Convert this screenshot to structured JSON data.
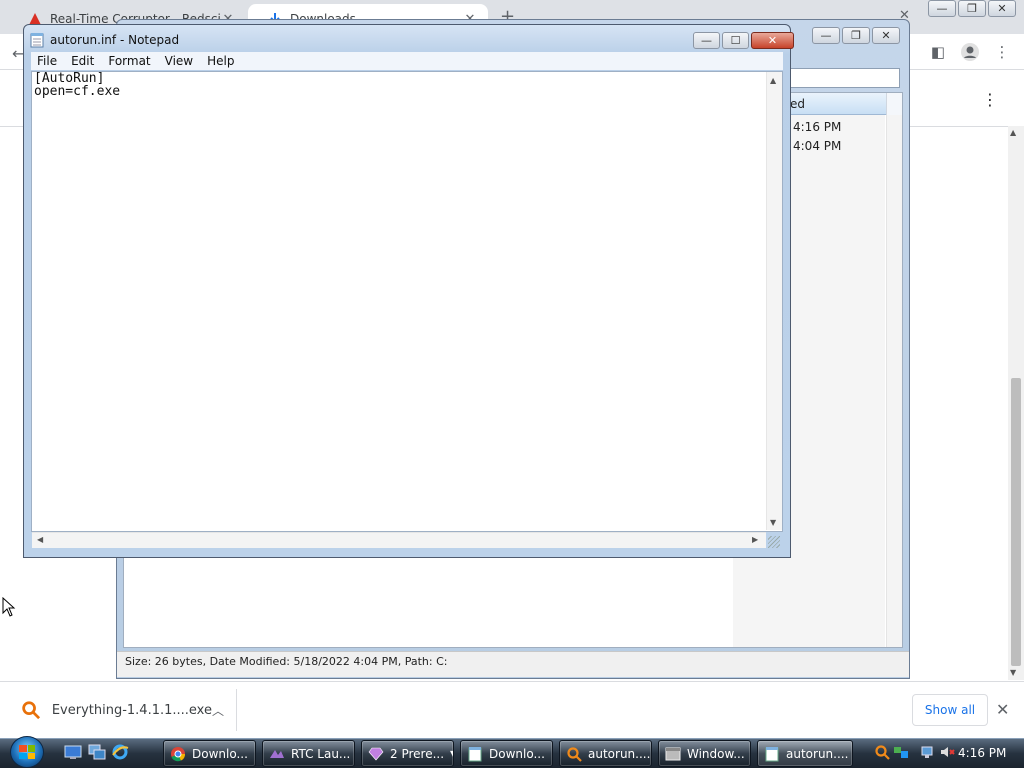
{
  "chrome": {
    "tabs": [
      {
        "title": "Real-Time Corruptor - Redscienti"
      },
      {
        "title": "Downloads"
      }
    ],
    "page_menu_icon": "more-vert-icon",
    "download_shelf": {
      "item_name": "Everything-1.4.1.1....exe",
      "show_all_label": "Show all"
    }
  },
  "everything": {
    "column_header": "ed",
    "rows": [
      "4:16 PM",
      "4:04 PM"
    ],
    "status_bar": "Size: 26 bytes, Date Modified: 5/18/2022 4:04 PM, Path: C:"
  },
  "notepad": {
    "title": "autorun.inf - Notepad",
    "menu": [
      "File",
      "Edit",
      "Format",
      "View",
      "Help"
    ],
    "content": "[AutoRun]\nopen=cf.exe"
  },
  "taskbar": {
    "buttons": [
      {
        "label": "Downlo...",
        "icon": "chrome-icon"
      },
      {
        "label": "RTC Lau...",
        "icon": "rtc-icon"
      },
      {
        "label": "2 Prere...",
        "icon": "gem-icon"
      },
      {
        "label": "Downlo...",
        "icon": "notepad-icon"
      },
      {
        "label": "autorun....",
        "icon": "everything-icon"
      },
      {
        "label": "Window...",
        "icon": "window-icon"
      },
      {
        "label": "autorun....",
        "icon": "notepad-icon"
      }
    ],
    "clock": "4:16 PM"
  },
  "colors": {
    "chrome_accent": "#1a73e8",
    "notepad_close": "#c7432a",
    "taskbar": "#26323f"
  }
}
